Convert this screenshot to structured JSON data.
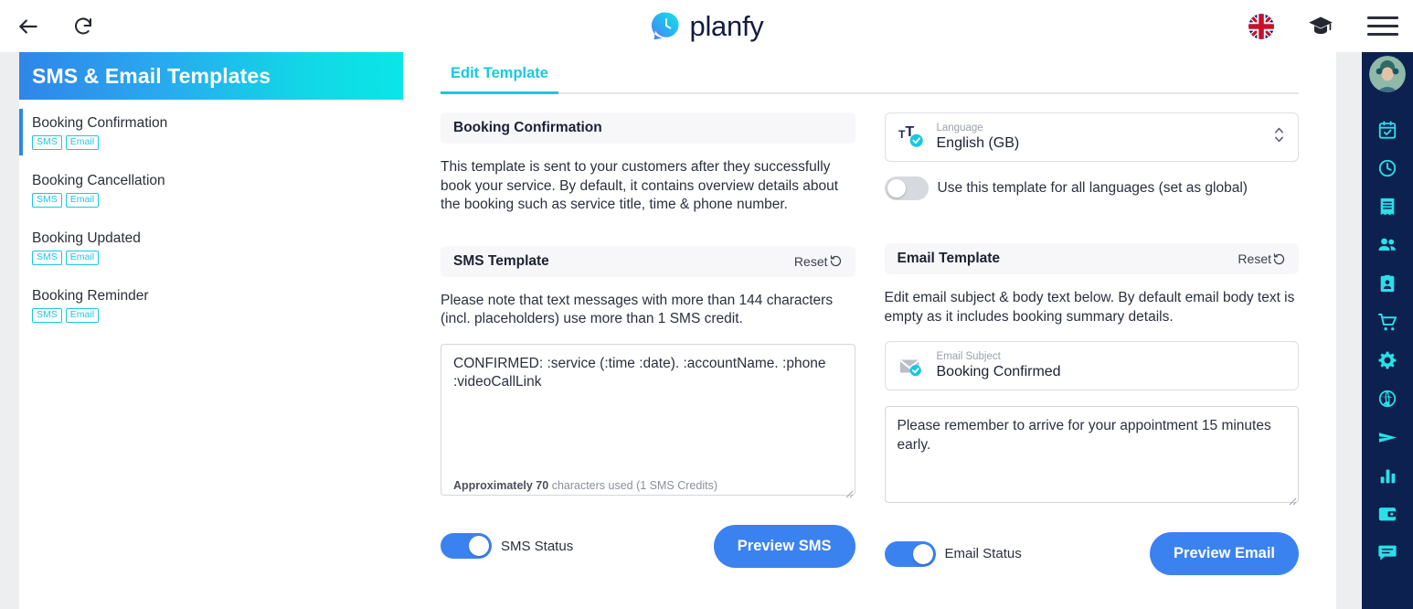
{
  "browser": {
    "back_icon": "arrow-left-icon",
    "reload_icon": "reload-icon"
  },
  "header": {
    "brand": "planfy",
    "logo_icon": "planfy-clock-bubble-logo",
    "flag_icon": "uk-flag-icon",
    "academy_icon": "graduation-cap-icon",
    "menu_icon": "hamburger-menu-icon"
  },
  "left_panel": {
    "title": "SMS & Email Templates",
    "items": [
      {
        "name": "Booking Confirmation",
        "badges": [
          "SMS",
          "Email"
        ],
        "active": true
      },
      {
        "name": "Booking Cancellation",
        "badges": [
          "SMS",
          "Email"
        ],
        "active": false
      },
      {
        "name": "Booking Updated",
        "badges": [
          "SMS",
          "Email"
        ],
        "active": false
      },
      {
        "name": "Booking Reminder",
        "badges": [
          "SMS",
          "Email"
        ],
        "active": false
      }
    ]
  },
  "main": {
    "tab_label": "Edit Template",
    "template_title": "Booking Confirmation",
    "template_description": "This template is sent to your customers after they successfully book your service. By default, it contains overview details about the booking such as service title, time & phone number.",
    "language": {
      "label": "Language",
      "value": "English (GB)",
      "icon": "translate-check-icon",
      "stepper_icon": "stepper-up-down-icon"
    },
    "global_toggle": {
      "label": "Use this template for all languages (set as global)",
      "state": "off"
    },
    "sms": {
      "section_title": "SMS Template",
      "reset_label": "Reset",
      "reset_icon": "reset-circular-arrow-icon",
      "note": "Please note that text messages with more than 144 characters (incl. placeholders) use more than 1 SMS credit.",
      "body": "CONFIRMED: :service (:time :date). :accountName. :phone :videoCallLink",
      "counter_bold": "Approximately 70",
      "counter_rest": " characters used (1 SMS Credits)",
      "status_label": "SMS Status",
      "status_state": "on",
      "preview_button": "Preview SMS"
    },
    "email": {
      "section_title": "Email Template",
      "reset_label": "Reset",
      "reset_icon": "reset-circular-arrow-icon",
      "note": "Edit email subject & body text below. By default email body text is empty as it includes booking summary details.",
      "subject_label": "Email Subject",
      "subject_value": "Booking Confirmed",
      "subject_icon": "envelope-check-icon",
      "body": "Please remember to arrive for your appointment 15 minutes early.",
      "status_label": "Email Status",
      "status_state": "on",
      "preview_button": "Preview Email"
    }
  },
  "rail": {
    "avatar_icon": "user-avatar",
    "icons": [
      "calendar-check-icon",
      "clock-icon",
      "receipt-icon",
      "people-icon",
      "contact-card-icon",
      "shopping-cart-icon",
      "gear-icon",
      "globe-icon",
      "send-icon",
      "bar-chart-icon",
      "wallet-icon",
      "chat-icon"
    ]
  },
  "colors": {
    "brand_blue": "#2f86e8",
    "brand_cyan": "#0ae6e6",
    "accent_cyan": "#19c8e0",
    "button_blue": "#3b82f1",
    "rail_navy": "#0d2150",
    "text_dark": "#1b2133"
  }
}
